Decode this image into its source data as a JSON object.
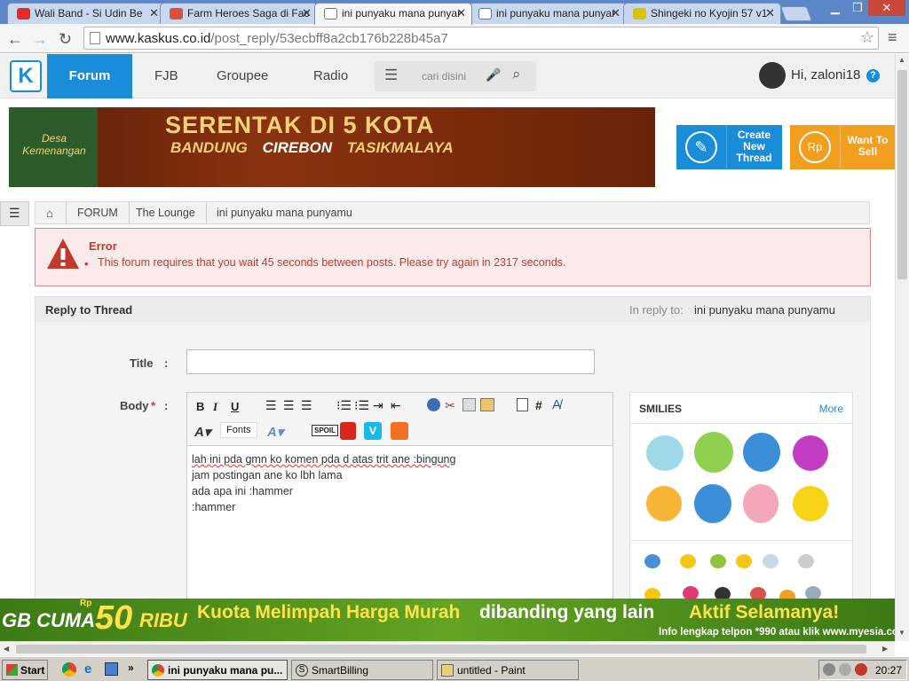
{
  "browser": {
    "tabs": [
      {
        "title": "Wali Band - Si Udin Be",
        "color": "#e52d27"
      },
      {
        "title": "Farm Heroes Saga di Fac",
        "color": "#d9533a"
      },
      {
        "title": "ini punyaku mana punyar",
        "color": "#1a8dd8"
      },
      {
        "title": "ini punyaku mana punyar",
        "color": "#1a8dd8"
      },
      {
        "title": "Shingeki no Kyojin 57 v1",
        "color": "#d9c200"
      }
    ],
    "url_host": "www.kaskus.co.id",
    "url_path": "/post_reply/53ecbff8a2cb176b228b45a7"
  },
  "header": {
    "nav": [
      "Forum",
      "FJB",
      "Groupee",
      "Radio"
    ],
    "search_placeholder": "cari disini",
    "greeting": "Hi, zaloni18",
    "help": "?"
  },
  "banner": {
    "headline": "SERENTAK DI 5 KOTA",
    "cities": [
      "BANDUNG",
      "CIREBON",
      "TASIKMALAYA"
    ],
    "logo_text": "Desa Kemenangan"
  },
  "cta": {
    "create": "Create New Thread",
    "sell": "Want To Sell",
    "sell_icon": "Rp"
  },
  "breadcrumb": [
    "FORUM",
    "The Lounge",
    "ini punyaku mana punyamu"
  ],
  "error": {
    "title": "Error",
    "message": "This forum requires that you wait 45 seconds between posts. Please try again in 2317 seconds."
  },
  "reply": {
    "heading": "Reply to Thread",
    "in_reply_label": "In reply to:",
    "in_reply_value": "ini punyaku mana punyamu",
    "title_label": "Title",
    "body_label": "Body",
    "required": "*",
    "fonts_label": "Fonts",
    "spoil_label": "SPOIL",
    "body_lines": [
      "lah ini pda gmn ko komen pda d atas trit ane :bingung",
      "jam postingan ane ko lbh lama",
      "ada apa ini :hammer",
      ":hammer"
    ]
  },
  "smilies": {
    "heading": "SMILIES",
    "more": "More"
  },
  "ad": {
    "left": "GB CUMA",
    "rp": "Rp",
    "price": "50",
    "unit": "RIBU",
    "slogan_a": "Kuota Melimpah Harga Murah",
    "slogan_b": "dibanding yang lain",
    "slogan_c": "Aktif Selamanya!",
    "info": "Info lengkap telpon *990 atau klik www.myesia.com"
  },
  "taskbar": {
    "start": "Start",
    "items": [
      "ini punyaku mana pu...",
      "SmartBilling",
      "untitled - Paint"
    ],
    "clock": "20:27"
  }
}
